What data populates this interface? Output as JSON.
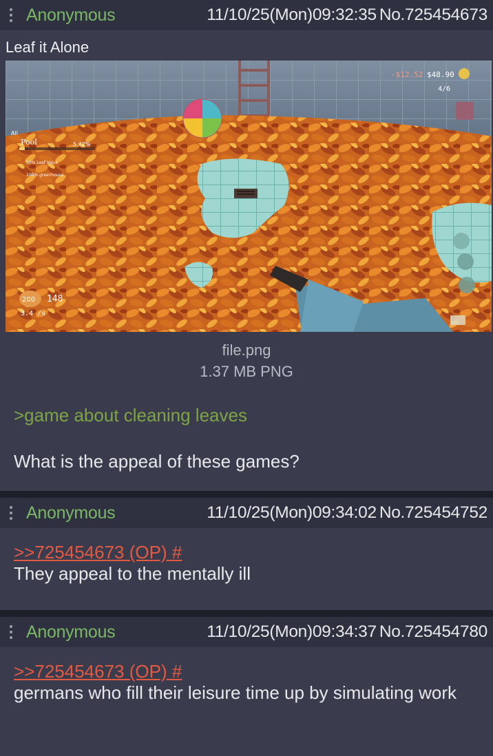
{
  "posts": [
    {
      "name": "Anonymous",
      "datetime": "11/10/25(Mon)09:32:35",
      "number": "No.725454673",
      "subject": "Leaf it Alone",
      "file": {
        "name": "file.png",
        "size": "1.37 MB PNG"
      },
      "greentext": ">game about cleaning leaves",
      "text": "What is the appeal of these games?"
    },
    {
      "name": "Anonymous",
      "datetime": "11/10/25(Mon)09:34:02",
      "number": "No.725454752",
      "quotelink": ">>725454673 (OP) #",
      "text": "They appeal to the mentally ill"
    },
    {
      "name": "Anonymous",
      "datetime": "11/10/25(Mon)09:34:37",
      "number": "No.725454780",
      "quotelink": ">>725454673 (OP) #",
      "text": "germans who fill their leisure time up by simulating work"
    }
  ],
  "game_hud": {
    "money_neg": "-$12.52",
    "money": "$48.90",
    "counter": "4/6",
    "filter": "All",
    "location": "Pool",
    "percent": "5.72%",
    "bonus1": "50% Leaf Value",
    "bonus2": "100% greenhouse",
    "bag_capacity": "200",
    "bag_count": "148",
    "rate": "3.4 /s"
  },
  "colors": {
    "name_green": "#79b865",
    "greentext": "#7ea443",
    "quotelink": "#e25a42",
    "post_bg": "#3a3c4e",
    "header_bg": "#2f3140"
  }
}
